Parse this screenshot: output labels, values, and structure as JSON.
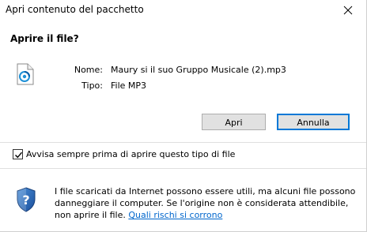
{
  "window": {
    "title": "Apri contenuto del pacchetto",
    "close_icon": "close-icon"
  },
  "dialog": {
    "heading": "Aprire il file?",
    "file_icon": "audio-file-icon",
    "name_label": "Nome:",
    "name_value": "Maury  si  il  suo  Gruppo  Musicale  (2).mp3",
    "type_label": "Tipo:",
    "type_value": "File MP3"
  },
  "buttons": {
    "open_label": "Apri",
    "cancel_label": "Annulla"
  },
  "checkbox": {
    "label": "Avvisa sempre prima di aprire questo tipo di file",
    "checked": true
  },
  "warning": {
    "icon": "shield-icon",
    "line1": "I file scaricati da Internet possono essere utili, ma alcuni file possono",
    "line2": "danneggiare il computer. Se l'origine non è considerata attendibile,",
    "line3_prefix": "non aprire il file. ",
    "link_label": "Quali rischi si corrono"
  },
  "colors": {
    "accent": "#0078d7",
    "link": "#0066cc",
    "button_bg": "#e1e1e1"
  }
}
